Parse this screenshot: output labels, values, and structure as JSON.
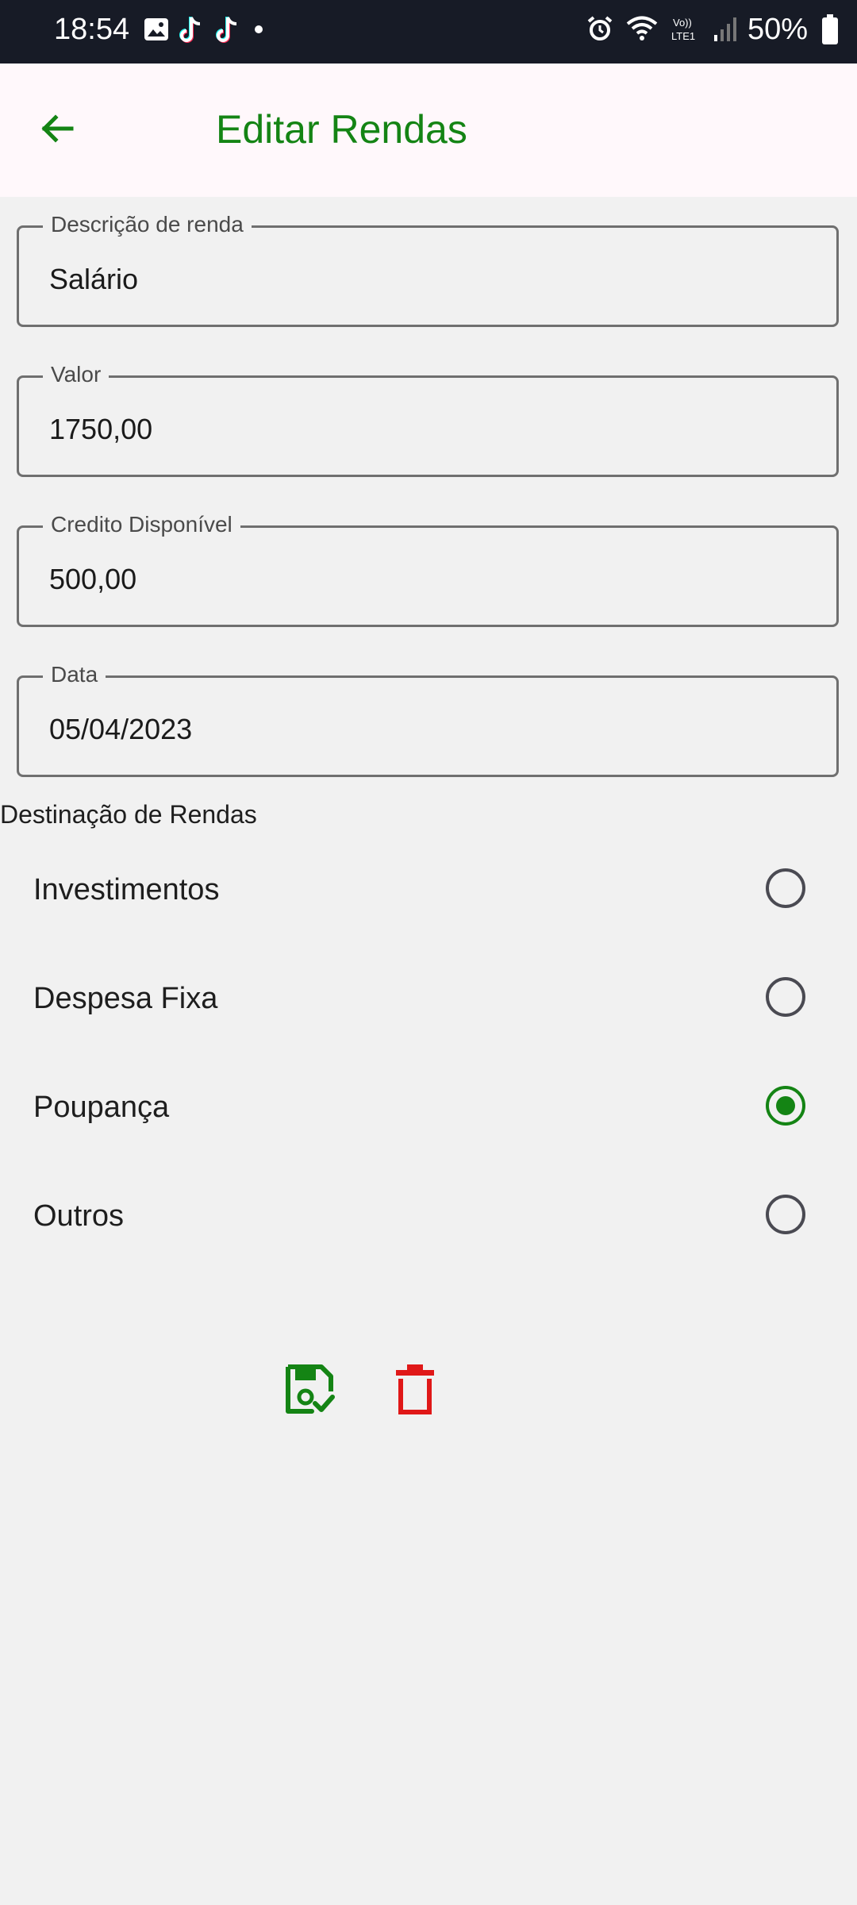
{
  "status_bar": {
    "time": "18:54",
    "left_icons": [
      "gallery-icon",
      "tiktok-icon",
      "tiktok-icon",
      "dot-icon"
    ],
    "right_icons": [
      "alarm-icon",
      "wifi-icon",
      "volte-lte1-icon",
      "signal-icon"
    ],
    "battery": "50%"
  },
  "app_bar": {
    "back_icon": "arrow-left-icon",
    "title": "Editar Rendas"
  },
  "form": {
    "description": {
      "label": "Descrição de renda",
      "value": "Salário"
    },
    "value": {
      "label": "Valor",
      "value": "1750,00"
    },
    "credit": {
      "label": "Credito Disponível",
      "value": "500,00"
    },
    "date": {
      "label": "Data",
      "value": "05/04/2023"
    }
  },
  "destination": {
    "title": "Destinação de Rendas",
    "options": [
      {
        "label": "Investimentos",
        "selected": false
      },
      {
        "label": "Despesa Fixa",
        "selected": false
      },
      {
        "label": "Poupança",
        "selected": true
      },
      {
        "label": "Outros",
        "selected": false
      }
    ]
  },
  "actions": {
    "save_icon": "save-check-icon",
    "delete_icon": "trash-icon"
  },
  "colors": {
    "accent": "#148414",
    "danger": "#e01818",
    "status_bar": "#171b26",
    "app_bar": "#fff8fb",
    "background": "#f1f1f1"
  }
}
